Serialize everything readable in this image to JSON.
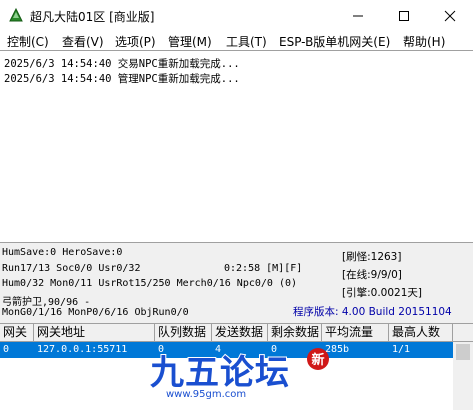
{
  "window": {
    "title": "超凡大陆01区 [商业版]"
  },
  "menu": [
    {
      "name": "menu-control",
      "label": "控制(C)"
    },
    {
      "name": "menu-view",
      "label": "查看(V)"
    },
    {
      "name": "menu-options",
      "label": "选项(P)"
    },
    {
      "name": "menu-manage",
      "label": "管理(M)"
    },
    {
      "name": "menu-tools",
      "label": "工具(T)"
    },
    {
      "name": "menu-espb",
      "label": "ESP-B版单机网关(E)"
    },
    {
      "name": "menu-help",
      "label": "帮助(H)"
    }
  ],
  "log": [
    "2025/6/3 14:54:40 交易NPC重新加载完成...",
    "2025/6/3 14:54:40 管理NPC重新加载完成..."
  ],
  "status": {
    "line1": "HumSave:0 HeroSave:0",
    "line2": "Run17/13 Soc0/0 Usr0/32",
    "clock": "0:2:58 [M][F]",
    "line3": "Hum0/32 Mon0/11 UsrRot15/250 Merch0/16 Npc0/0 (0)",
    "line4": "弓箭护卫,90/96 -",
    "line5": "MonG0/1/16 MonP0/6/16 ObjRun0/0",
    "refresh": "[刷怪:1263]",
    "online": "[在线:9/9/0]",
    "engine": "[引擎:0.0021天]",
    "version": "程序版本: 4.00 Build 20151104"
  },
  "grid": {
    "headers": [
      "网关",
      "网关地址",
      "队列数据",
      "发送数据",
      "剩余数据",
      "平均流量",
      "最高人数"
    ],
    "rows": [
      [
        "0",
        "127.0.0.1:55711",
        "0",
        "4",
        "0",
        "285b",
        "1/1"
      ]
    ]
  },
  "watermark": {
    "text": "九五论坛",
    "url": "www.95gm.com",
    "seal": "新"
  },
  "colors": {
    "selection": "#0078d7",
    "version_text": "#0000a8",
    "watermark": "#1a4fd0",
    "seal": "#d01818"
  }
}
